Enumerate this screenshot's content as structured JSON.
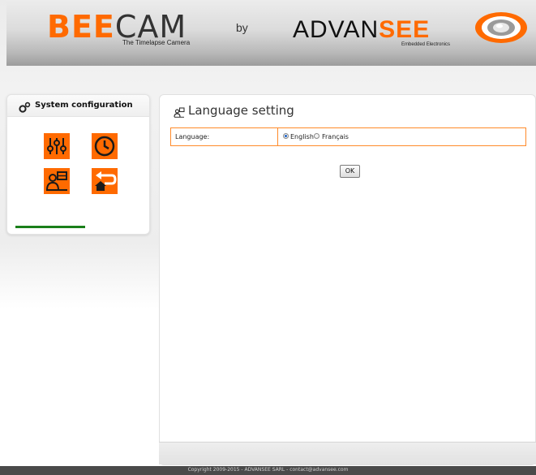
{
  "header": {
    "brand_prefix": "BEE",
    "brand_suffix": "CAM",
    "tagline": "The Timelapse Camera",
    "by": "by",
    "partner_main": "ADVAN",
    "partner_see": "SEE",
    "partner_tagline": "Embedded Electronics"
  },
  "sidebar": {
    "title": "System configuration",
    "tiles": [
      {
        "icon": "equalizer-icon"
      },
      {
        "icon": "clock-icon"
      },
      {
        "icon": "language-icon"
      },
      {
        "icon": "home-return-icon"
      }
    ]
  },
  "main": {
    "title": "Language setting",
    "field_label": "Language:",
    "options": [
      {
        "label": "English",
        "selected": true
      },
      {
        "label": "Français",
        "selected": false
      }
    ],
    "ok_label": "OK"
  },
  "footer": {
    "copyright": "Copyright 2009-2015 - ADVANSEE SARL - contact@advansee.com"
  },
  "colors": {
    "accent": "#ff6a00",
    "progress": "#1a7f1a"
  }
}
